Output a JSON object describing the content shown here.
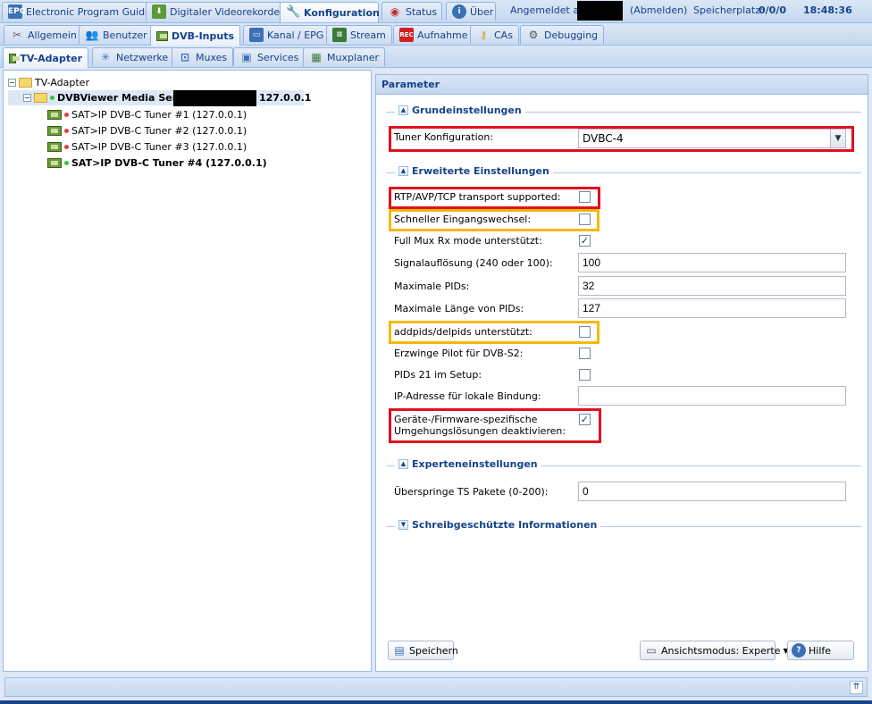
{
  "topbar": {
    "tabs": [
      {
        "label": "Electronic Program Guide",
        "icon": "epg-icon"
      },
      {
        "label": "Digitaler Videorekorder",
        "icon": "download-icon"
      },
      {
        "label": "Konfiguration",
        "icon": "wrench-icon"
      },
      {
        "label": "Status",
        "icon": "eye-icon"
      },
      {
        "label": "Über",
        "icon": "info-icon"
      }
    ],
    "logged_in_label": "Angemeldet als",
    "logout_label": "(Abmelden)",
    "storage_label": "Speicherplatz:",
    "storage_value": "0/0/0",
    "clock": "18:48:36"
  },
  "config_tabs": [
    {
      "label": "Allgemein",
      "icon": "tools-icon"
    },
    {
      "label": "Benutzer",
      "icon": "users-icon"
    },
    {
      "label": "DVB-Inputs",
      "icon": "tuner-icon"
    },
    {
      "label": "Kanal / EPG",
      "icon": "tv-icon"
    },
    {
      "label": "Stream",
      "icon": "stream-icon"
    },
    {
      "label": "Aufnahme",
      "icon": "rec-icon"
    },
    {
      "label": "CAs",
      "icon": "key-icon"
    },
    {
      "label": "Debugging",
      "icon": "bug-icon"
    }
  ],
  "dvb_tabs": [
    {
      "label": "TV-Adapter",
      "icon": "tuner-icon"
    },
    {
      "label": "Netzwerke",
      "icon": "antenna-icon"
    },
    {
      "label": "Muxes",
      "icon": "satellite-icon"
    },
    {
      "label": "Services",
      "icon": "tv-icon"
    },
    {
      "label": "Muxplaner",
      "icon": "calendar-icon"
    }
  ],
  "tree": {
    "root": "TV-Adapter",
    "server_name": "DVBViewer Media Server",
    "server_ip": "127.0.0.1",
    "tuners": [
      {
        "label": "SAT>IP DVB-C Tuner #1 (127.0.0.1)",
        "status_color": "#e04040",
        "selected": false
      },
      {
        "label": "SAT>IP DVB-C Tuner #2 (127.0.0.1)",
        "status_color": "#e04040",
        "selected": false
      },
      {
        "label": "SAT>IP DVB-C Tuner #3 (127.0.0.1)",
        "status_color": "#e04040",
        "selected": false
      },
      {
        "label": "SAT>IP DVB-C Tuner #4 (127.0.0.1)",
        "status_color": "#40c040",
        "selected": true
      }
    ]
  },
  "params": {
    "title": "Parameter",
    "basic": {
      "legend": "Grundeinstellungen",
      "tuner_config_label": "Tuner Konfiguration:",
      "tuner_config_value": "DVBC-4"
    },
    "advanced": {
      "legend": "Erweiterte Einstellungen",
      "rtp_label": "RTP/AVP/TCP transport supported:",
      "rtp_checked": false,
      "fast_switch_label": "Schneller Eingangswechsel:",
      "fast_switch_checked": false,
      "fullmux_label": "Full Mux Rx mode unterstützt:",
      "fullmux_checked": true,
      "signal_label": "Signalauflösung (240 oder 100):",
      "signal_value": "100",
      "maxpids_label": "Maximale PIDs:",
      "maxpids_value": "32",
      "maxlen_label": "Maximale Länge von PIDs:",
      "maxlen_value": "127",
      "addpids_label": "addpids/delpids unterstützt:",
      "addpids_checked": false,
      "pilot_label": "Erzwinge Pilot für DVB-S2:",
      "pilot_checked": false,
      "pids21_label": "PIDs 21 im Setup:",
      "pids21_checked": false,
      "ip_label": "IP-Adresse für lokale Bindung:",
      "ip_value": "",
      "fw_label_1": "Geräte-/Firmware-spezifische",
      "fw_label_2": "Umgehungslösungen deaktivieren:",
      "fw_checked": true
    },
    "expert": {
      "legend": "Experteneinstellungen",
      "skip_ts_label": "Überspringe TS Pakete (0-200):",
      "skip_ts_value": "0"
    },
    "readonly": {
      "legend": "Schreibgeschützte Informationen"
    },
    "buttons": {
      "save": "Speichern",
      "view_mode": "Ansichtsmodus: Experte",
      "help": "Hilfe"
    }
  },
  "colors": {
    "highlight_red": "#e01020",
    "highlight_yellow": "#f5b800",
    "accent": "#15428b"
  }
}
